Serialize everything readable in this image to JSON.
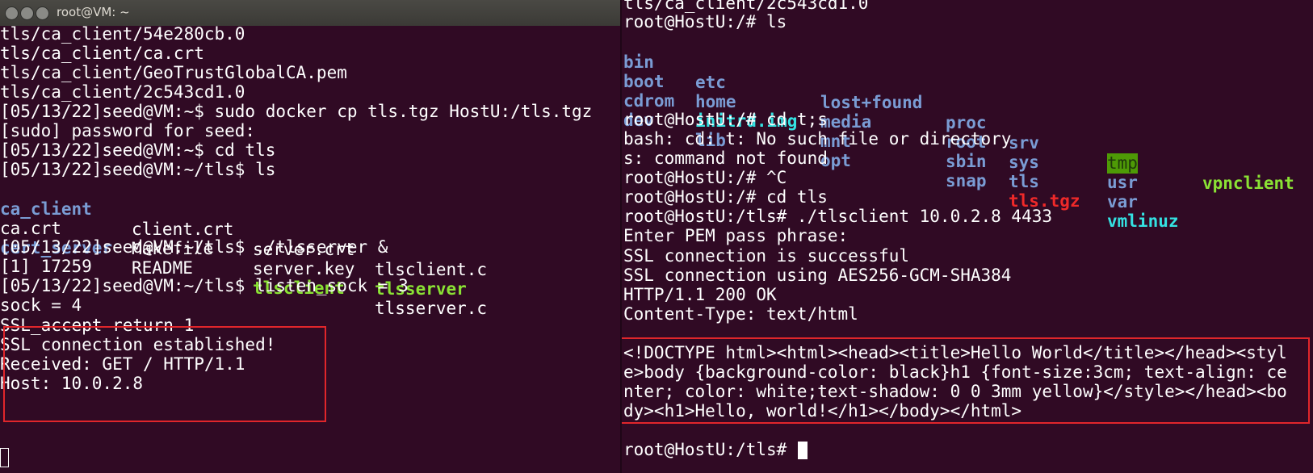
{
  "left_window": {
    "title": "root@VM: ~",
    "lines": [
      "tls/ca_client/54e280cb.0",
      "tls/ca_client/ca.crt",
      "tls/ca_client/GeoTrustGlobalCA.pem",
      "tls/ca_client/2c543cd1.0",
      "[05/13/22]seed@VM:~$ sudo docker cp tls.tgz HostU:/tls.tgz",
      "[sudo] password for seed:",
      "[05/13/22]seed@VM:~$ cd tls",
      "[05/13/22]seed@VM:~/tls$ ls"
    ],
    "ls_grid": [
      [
        "ca_client",
        "client.crt",
        "server.crt",
        "tlsclient.c"
      ],
      [
        "ca.crt",
        "Makefile",
        "server.key",
        "tlsserver"
      ],
      [
        "cert_server",
        "README",
        "tlsclient",
        "tlsserver.c"
      ]
    ],
    "lines_after": [
      "[05/13/22]seed@VM:~/tls$ ./tlsserver &",
      "[1] 17259",
      "[05/13/22]seed@VM:~/tls$ listen_sock = 3",
      "sock = 4",
      "SSL_accept return 1",
      "SSL connection established!",
      "Received: GET / HTTP/1.1",
      "Host: 10.0.2.8"
    ]
  },
  "right_window": {
    "top_partial": "tls/ca_client/2c543cd1.0",
    "prompt_ls": "root@HostU:/# ls",
    "ls_grid": [
      [
        "bin",
        "etc",
        "lost+found",
        "proc",
        "srv",
        "tmp",
        "vpnclient"
      ],
      [
        "boot",
        "home",
        "media",
        "root",
        "sys",
        "usr",
        ""
      ],
      [
        "cdrom",
        "initrd.img",
        "mnt",
        "sbin",
        "tls",
        "var",
        ""
      ],
      [
        "dev",
        "lib",
        "opt",
        "snap",
        "tls.tgz",
        "vmlinuz",
        ""
      ]
    ],
    "lines": [
      "root@HostU:/# cd t;s",
      "bash: cd: t: No such file or directory",
      "s: command not found",
      "root@HostU:/# ^C",
      "root@HostU:/# cd tls",
      "root@HostU:/tls# ./tlsclient 10.0.2.8 4433",
      "Enter PEM pass phrase:",
      "SSL connection is successful",
      "SSL connection using AES256-GCM-SHA384",
      "HTTP/1.1 200 OK",
      "Content-Type: text/html"
    ],
    "html_lines": [
      "<!DOCTYPE html><html><head><title>Hello World</title></head><styl",
      "e>body {background-color: black}h1 {font-size:3cm; text-align: ce",
      "nter; color: white;text-shadow: 0 0 3mm yellow}</style></head><bo",
      "dy><h1>Hello, world!</h1></body></html>"
    ],
    "final_prompt": "root@HostU:/tls# "
  },
  "colors": {
    "background": "#300a24",
    "directory": "#7a9cd4",
    "executable": "#8ae234",
    "image_file": "#34e2e2",
    "archive": "#ef2929",
    "highlight_box": "#e0262b"
  },
  "icons": [
    "close-icon",
    "minimize-icon",
    "maximize-icon"
  ]
}
